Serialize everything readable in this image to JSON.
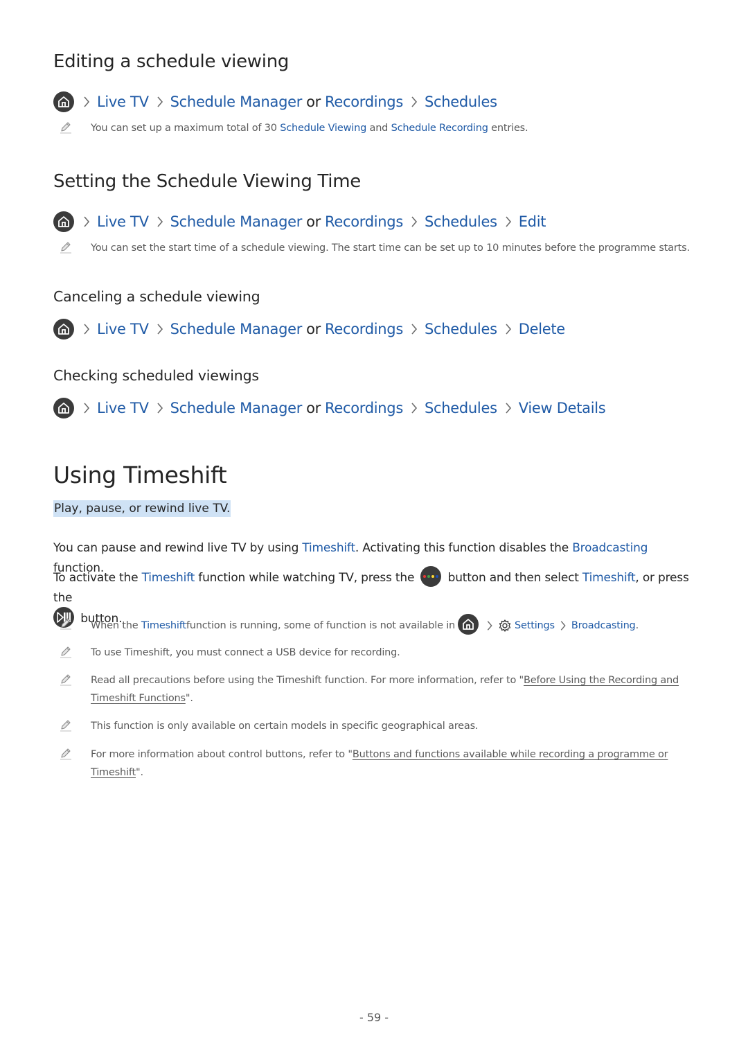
{
  "sections": {
    "editing": {
      "title": "Editing a schedule viewing",
      "path": [
        "Live TV",
        "Schedule Manager",
        "or",
        "Recordings",
        "Schedules"
      ],
      "note": {
        "pre": "You can set up a maximum total of 30 ",
        "link1": "Schedule Viewing",
        "mid": " and ",
        "link2": "Schedule Recording",
        "post": " entries."
      }
    },
    "setting_time": {
      "title": "Setting the Schedule Viewing Time",
      "path": [
        "Live TV",
        "Schedule Manager",
        "or",
        "Recordings",
        "Schedules",
        "Edit"
      ],
      "note": "You can set the start time of a schedule viewing. The start time can be set up to 10 minutes before the programme starts."
    },
    "canceling": {
      "title": "Canceling a schedule viewing",
      "path": [
        "Live TV",
        "Schedule Manager",
        "or",
        "Recordings",
        "Schedules",
        "Delete"
      ]
    },
    "checking": {
      "title": "Checking scheduled viewings",
      "path": [
        "Live TV",
        "Schedule Manager",
        "or",
        "Recordings",
        "Schedules",
        "View Details"
      ]
    }
  },
  "timeshift": {
    "title": "Using Timeshift",
    "subtitle": "Play, pause, or rewind live TV.",
    "para1": {
      "a": "You can pause and rewind live TV by using ",
      "b": "Timeshift",
      "c": ". Activating this function disables the ",
      "d": "Broadcasting",
      "e": " function."
    },
    "para2": {
      "a": "To activate the ",
      "b": "Timeshift",
      "c": " function while watching TV, press the ",
      "d": " button and then select ",
      "e": "Timeshift",
      "f": ", or press the",
      "g": " button."
    },
    "color_button_dots": [
      "#e53935",
      "#43a047",
      "#fdd835",
      "#1e4fb5"
    ],
    "notes": [
      {
        "a": "When the ",
        "b": "Timeshift",
        "c": " function is running, some of function is not available in ",
        "settings": "Settings",
        "broadcasting": "Broadcasting",
        "end": "."
      },
      {
        "text": "To use Timeshift, you must connect a USB device for recording."
      },
      {
        "a": "Read all precautions before using the Timeshift function. For more information, refer to \"",
        "link": "Before Using the Recording and Timeshift Functions",
        "end": "\"."
      },
      {
        "text": "This function is only available on certain models in specific geographical areas."
      },
      {
        "a": "For more information about control buttons, refer to \"",
        "link": "Buttons and functions available while recording a programme or Timeshift",
        "end": "\"."
      }
    ]
  },
  "footer": {
    "page_number": "- 59 -"
  },
  "colors": {
    "link_blue": "#1f5aa6",
    "text": "#252525",
    "highlight": "#cfe2f5",
    "icon_bg": "#3b3b3b"
  }
}
